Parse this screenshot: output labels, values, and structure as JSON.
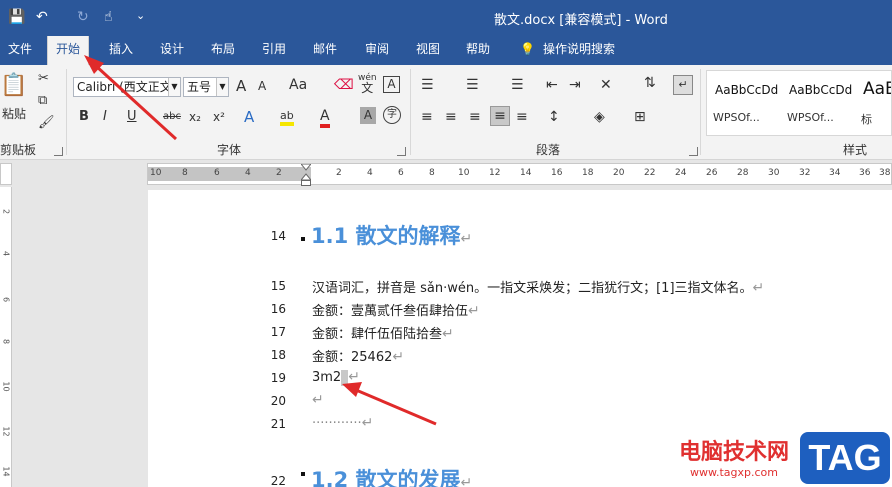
{
  "window": {
    "title": "散文.docx [兼容模式]  -  Word",
    "qa_save": "💾",
    "qa_undo": "↶",
    "qa_redo": "↻",
    "qa_touch": "☝",
    "qa_more": "⌄"
  },
  "tabs": [
    {
      "label": "文件"
    },
    {
      "label": "开始"
    },
    {
      "label": "插入"
    },
    {
      "label": "设计"
    },
    {
      "label": "布局"
    },
    {
      "label": "引用"
    },
    {
      "label": "邮件"
    },
    {
      "label": "审阅"
    },
    {
      "label": "视图"
    },
    {
      "label": "帮助"
    },
    {
      "label": "操作说明搜索"
    }
  ],
  "ribbon": {
    "clipboard": {
      "label": "剪贴板",
      "paste": "粘贴"
    },
    "font": {
      "label": "字体",
      "font_name": "Calibri (西文正文",
      "font_size": "五号",
      "grow": "A",
      "shrink": "A",
      "case": "Aa",
      "pinyin": "wén",
      "pinyin_char": "文",
      "bold": "B",
      "italic": "I",
      "underline": "U",
      "strike": "abc",
      "sub": "x₂",
      "sup": "x²",
      "effects": "A",
      "highlight": "ab",
      "font_color": "A",
      "shading": "A",
      "enclose": "字"
    },
    "paragraph": {
      "label": "段落"
    },
    "styles": {
      "label": "样式",
      "items": [
        {
          "sample": "AaBbCcDd",
          "name": "WPSOf..."
        },
        {
          "sample": "AaBbCcDd",
          "name": "WPSOf..."
        },
        {
          "sample": "AaB",
          "name": "标"
        }
      ]
    }
  },
  "ruler": {
    "ticks": [
      "10",
      "8",
      "6",
      "4",
      "2",
      "2",
      "4",
      "6",
      "8",
      "10",
      "12",
      "14",
      "16",
      "18",
      "20",
      "22",
      "24",
      "26",
      "28",
      "30",
      "32",
      "34",
      "36",
      "38"
    ]
  },
  "vruler": {
    "ticks": [
      "2",
      "4",
      "6",
      "8",
      "10",
      "12",
      "14"
    ]
  },
  "document": {
    "lines": [
      {
        "num": "14",
        "text": "1.1 散文的解释",
        "heading": true
      },
      {
        "num": "15",
        "text": "汉语词汇，拼音是 sǎn·wén。一指文采焕发；二指犹行文；[1]三指文体名。"
      },
      {
        "num": "16",
        "text": "金额：壹萬贰仟叁佰肆拾伍"
      },
      {
        "num": "17",
        "text": "金额：肆仟伍佰陆拾叁"
      },
      {
        "num": "18",
        "text": "金额：25462"
      },
      {
        "num": "19",
        "text": "3m2"
      },
      {
        "num": "20",
        "text": ""
      },
      {
        "num": "21",
        "text": "············"
      },
      {
        "num": "22",
        "text": "1.2 散文的发展",
        "heading": true
      }
    ],
    "para_mark": "↵"
  },
  "watermark": {
    "site_name": "电脑技术网",
    "site_url": "www.tagxp.com",
    "logo": "TAG"
  },
  "colors": {
    "accent": "#2b579a",
    "heading": "#4a90d9",
    "arrow": "#e02a2a"
  }
}
